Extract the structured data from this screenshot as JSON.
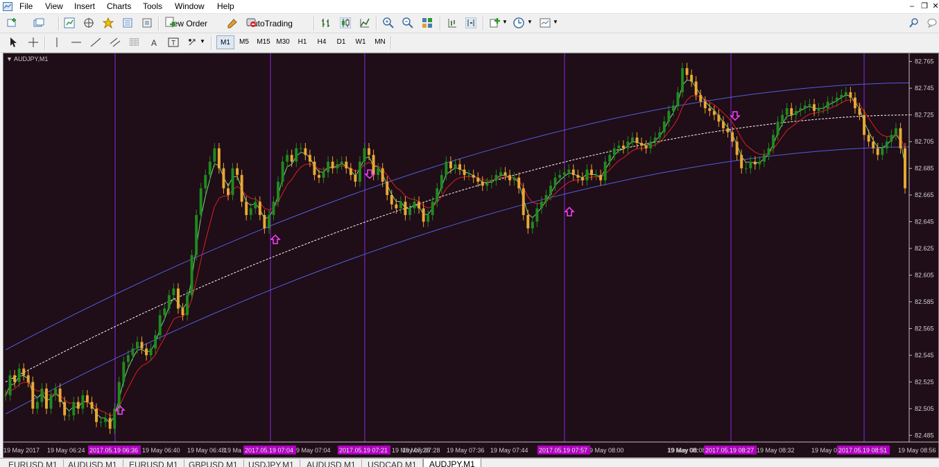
{
  "menu": [
    "File",
    "View",
    "Insert",
    "Charts",
    "Tools",
    "Window",
    "Help"
  ],
  "toolbar": {
    "new_order": "New Order",
    "autotrading": "AutoTrading",
    "timeframes": [
      "M1",
      "M5",
      "M15",
      "M30",
      "H1",
      "H4",
      "D1",
      "W1",
      "MN"
    ],
    "active_timeframe": "M1"
  },
  "chart": {
    "symbol_label": "AUDJPY,M1",
    "background": "#1f0d17",
    "bull_color": "#1f8a1f",
    "bear_color": "#e8a834",
    "price_labels": [
      "82.765",
      "82.745",
      "82.725",
      "82.705",
      "82.685",
      "82.665",
      "82.645",
      "82.625",
      "82.605",
      "82.585",
      "82.565",
      "82.545",
      "82.525",
      "82.505",
      "82.485"
    ],
    "time_labels": [
      "19 May 2017",
      "19 May 06:24",
      "19 May 06:40",
      "19 May 06:48",
      "19 May 07:04",
      "19 May 07:20",
      "19 May 07:28",
      "19 May 07:36",
      "19 May 07:44",
      "19 May 08:00",
      "19 May 08:08",
      "19 May 08:32",
      "19 May 08:56"
    ],
    "time_labels_partial": [
      "19 Ma",
      "19 May 08:",
      "19 May 08:"
    ],
    "highlighted_times": [
      "2017.05.19 06:36",
      "2017.05.19 07:04",
      "2017.05.19 07:21",
      "2017.05.19 07:57",
      "2017.05.19 08:27",
      "2017.05.19 08:51"
    ]
  },
  "tabs": [
    "EURUSD,M1",
    "AUDUSD,M1",
    "EURUSD,M1",
    "GBPUSD,M1",
    "USDJPY,M1",
    "AUDUSD,M1",
    "USDCAD,M1",
    "AUDJPY,M1"
  ],
  "active_tab": "AUDJPY,M1",
  "chart_data": {
    "type": "candlestick",
    "title": "AUDJPY,M1",
    "ylim": [
      82.48,
      82.77
    ],
    "y_ticks": [
      82.765,
      82.745,
      82.725,
      82.705,
      82.685,
      82.665,
      82.645,
      82.625,
      82.605,
      82.585,
      82.565,
      82.545,
      82.525,
      82.505,
      82.485
    ],
    "closes": [
      82.515,
      82.53,
      82.525,
      82.535,
      82.53,
      82.525,
      82.505,
      82.51,
      82.52,
      82.505,
      82.515,
      82.52,
      82.51,
      82.5,
      82.5,
      82.51,
      82.505,
      82.515,
      82.51,
      82.505,
      82.495,
      82.495,
      82.498,
      82.49,
      82.505,
      82.525,
      82.54,
      82.545,
      82.55,
      82.555,
      82.55,
      82.545,
      82.55,
      82.56,
      82.575,
      82.58,
      82.59,
      82.595,
      82.58,
      82.575,
      82.59,
      82.62,
      82.65,
      82.67,
      82.68,
      82.69,
      82.7,
      82.685,
      82.67,
      82.665,
      82.685,
      82.68,
      82.66,
      82.65,
      82.655,
      82.66,
      82.65,
      82.64,
      82.65,
      82.66,
      82.675,
      82.69,
      82.695,
      82.69,
      82.7,
      82.7,
      82.695,
      82.69,
      82.68,
      82.678,
      82.682,
      82.69,
      82.685,
      82.688,
      82.69,
      82.685,
      82.68,
      82.675,
      82.69,
      82.7,
      82.695,
      82.68,
      82.685,
      82.675,
      82.665,
      82.658,
      82.655,
      82.66,
      82.65,
      82.655,
      82.66,
      82.655,
      82.645,
      82.65,
      82.66,
      82.67,
      82.68,
      82.69,
      82.685,
      82.688,
      82.684,
      82.68,
      82.68,
      82.678,
      82.675,
      82.672,
      82.674,
      82.676,
      82.68,
      82.682,
      82.68,
      82.676,
      82.678,
      82.67,
      82.65,
      82.64,
      82.645,
      82.655,
      82.66,
      82.665,
      82.672,
      82.678,
      82.68,
      82.682,
      82.684,
      82.68,
      82.678,
      82.676,
      82.684,
      82.68,
      82.68,
      82.676,
      82.69,
      82.695,
      82.7,
      82.702,
      82.7,
      82.705,
      82.708,
      82.704,
      82.702,
      82.7,
      82.705,
      82.708,
      82.712,
      82.72,
      82.728,
      82.732,
      82.742,
      82.76,
      82.755,
      82.75,
      82.74,
      82.735,
      82.73,
      82.728,
      82.725,
      82.72,
      82.715,
      82.712,
      82.705,
      82.695,
      82.685,
      82.685,
      82.69,
      82.688,
      82.69,
      82.695,
      82.7,
      82.71,
      82.72,
      82.725,
      82.73,
      82.725,
      82.728,
      82.73,
      82.732,
      82.733,
      82.728,
      82.73,
      82.73,
      82.735,
      82.735,
      82.738,
      82.74,
      82.742,
      82.738,
      82.73,
      82.725,
      82.71,
      82.705,
      82.7,
      82.695,
      82.7,
      82.705,
      82.71,
      82.715,
      82.7,
      82.67
    ],
    "xlabel": "",
    "ylabel": ""
  }
}
